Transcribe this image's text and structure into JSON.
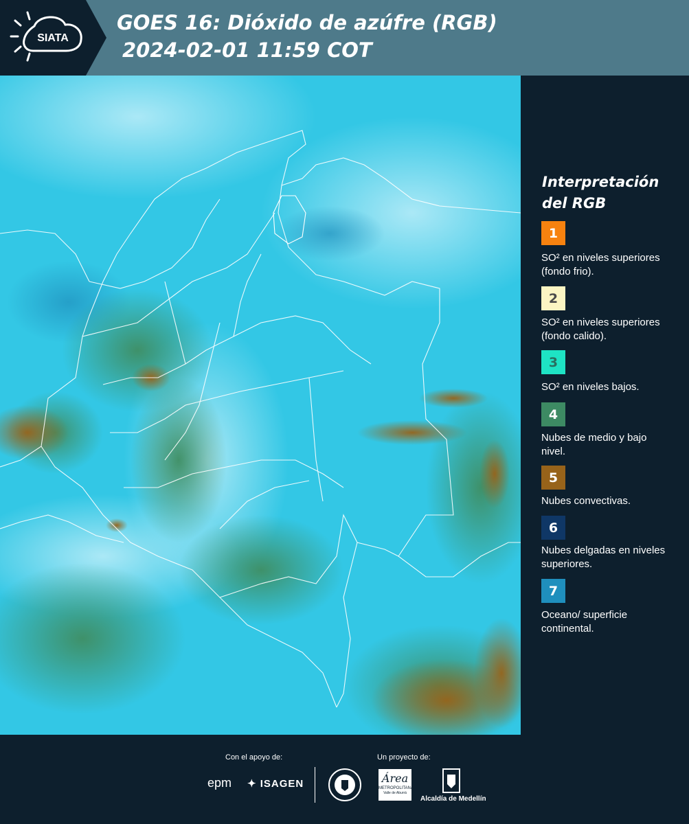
{
  "header": {
    "logo_text": "SIATA",
    "title_line1": "GOES 16: Dióxido de azúfre (RGB)",
    "title_line2": "2024-02-01 11:59 COT"
  },
  "map": {
    "content": "satellite-rgb-image",
    "ocean_color": "#33c7e5",
    "border_color": "#ffffff"
  },
  "legend": {
    "title": "Interpretación del RGB",
    "items": [
      {
        "number": "1",
        "color": "#f7820f",
        "text_color": "#ffffff",
        "description": "SO² en niveles superiores (fondo frio)."
      },
      {
        "number": "2",
        "color": "#fbf5c3",
        "text_color": "#4a4a4a",
        "description": "SO² en niveles superiores (fondo calido)."
      },
      {
        "number": "3",
        "color": "#1ee3c4",
        "text_color": "#2a6e5f",
        "description": "SO² en niveles bajos."
      },
      {
        "number": "4",
        "color": "#3d8a63",
        "text_color": "#ffffff",
        "description": "Nubes de medio y bajo nivel."
      },
      {
        "number": "5",
        "color": "#97631a",
        "text_color": "#ffffff",
        "description": "Nubes convectivas."
      },
      {
        "number": "6",
        "color": "#0f3766",
        "text_color": "#ffffff",
        "description": "Nubes delgadas en niveles superiores."
      },
      {
        "number": "7",
        "color": "#1f8fbd",
        "text_color": "#ffffff",
        "description": "Oceano/ superficie continental."
      }
    ]
  },
  "footer": {
    "support_label": "Con el apoyo de:",
    "project_label": "Un proyecto de:",
    "sponsors": {
      "epm": "epm",
      "isagen": "ISAGEN",
      "metropolitana": "Área",
      "metropolitana_sub": "METROPOLITANA",
      "metropolitana_sub2": "Valle de Aburrá",
      "alcaldia": "Alcaldía de Medellín"
    }
  }
}
